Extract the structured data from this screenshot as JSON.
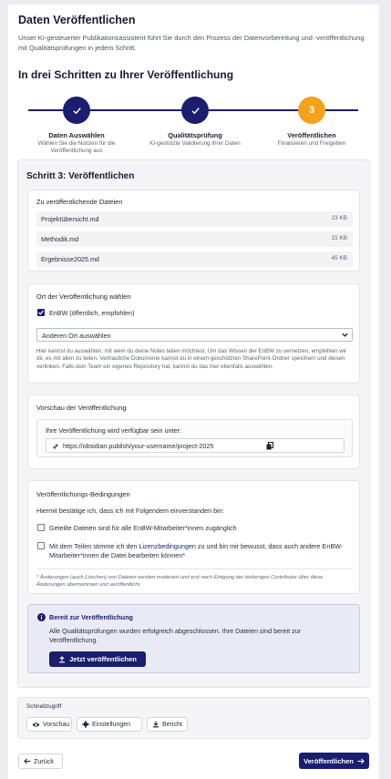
{
  "header": {
    "title": "Daten Veröffentlichen",
    "intro": "Unser KI-gesteuerter Publikationsassistent führt Sie durch den Prozess der Datenvorbereitung und -veröffentlichung mit Qualitätsprüfungen in jedem Schritt.",
    "subtitle": "In drei Schritten zu Ihrer Veröffentlichung"
  },
  "steps": [
    {
      "title": "Daten Auswählen",
      "subtitle": "Wählen Sie die Notizen für die Veröffentlichung aus",
      "status": "done"
    },
    {
      "title": "Qualitätsprüfung",
      "subtitle": "KI-gestützte Validierung Ihrer Daten",
      "status": "done"
    },
    {
      "title": "Veröffentlichen",
      "subtitle": "Finalisieren und Freigeben",
      "status": "active",
      "number": "3"
    }
  ],
  "step3": {
    "title": "Schritt 3: Veröffentlichen",
    "files": {
      "title": "Zu veröffentlichende Dateien",
      "items": [
        {
          "name": "Projektübersicht.md",
          "size": "23 KB"
        },
        {
          "name": "Methodik.md",
          "size": "15 KB"
        },
        {
          "name": "Ergebnisse2025.md",
          "size": "45 KB"
        }
      ]
    },
    "location": {
      "title": "Ort der Veröffentlichung wählen",
      "checkbox_label": "EnBW (öffentlich, empfohlen)",
      "checkbox_checked": true,
      "select_value": "Anderen Ort auswählen",
      "help": "Hier kannst du auswählen, mit wem du deine Notes teilen möchtest. Um das Wissen der EnBW zu vernetzen, empfehlen wir dir, es mit allen zu teilen. Vertrauliche Dokumente kannst du in einem geschützten SharePoint-Ordner speichern und diesen verlinken. Falls dein Team ein eigenes Repository hat, kannst du das hier ebenfalls auswählen."
    },
    "preview": {
      "title": "Vorschau der Veröffentlichung",
      "label": "Ihre Veröffentlichung wird verfügbar sein unter:",
      "url": "https://obsidian.publish/your-username/project-2025"
    },
    "conditions": {
      "title": "Veröffentlichungs-Bedingungen",
      "intro": "Hiermit bestätige ich, dass ich mit Folgendem einverstanden bin:",
      "item1": "Geteilte Dateien sind für alle EnBW-Mitarbeiter*innen zugänglich",
      "item2_pre": "Mit dem Teilen stimme ich den ",
      "item2_link": "Lizenzbedingungen",
      "item2_post": " zu und bin mir bewusst, dass auch andere EnBW-Mitarbeiter*innen die Datei bearbeiten können*",
      "footnote": "* Änderungen (auch Löschen) von Dateien werden moderiert und erst nach Einigung der bisherigen Contributor über diese Änderungen übernommen und veröffentlicht."
    },
    "ready": {
      "title": "Bereit zur Veröffentlichung",
      "text": "Alle Qualitätsprüfungen wurden erfolgreich abgeschlossen. Ihre Dateien sind bereit zur Veröffentlichung.",
      "button": "Jetzt veröffentlichen"
    }
  },
  "quick_access": {
    "title": "Schnellzugriff",
    "buttons": [
      "Vorschau",
      "Einstellungen",
      "Bericht"
    ]
  },
  "footer": {
    "back": "Zurück",
    "next": "Veröffentlichen"
  },
  "colors": {
    "primary": "#1a1e6e",
    "accent": "#f3a21c"
  }
}
